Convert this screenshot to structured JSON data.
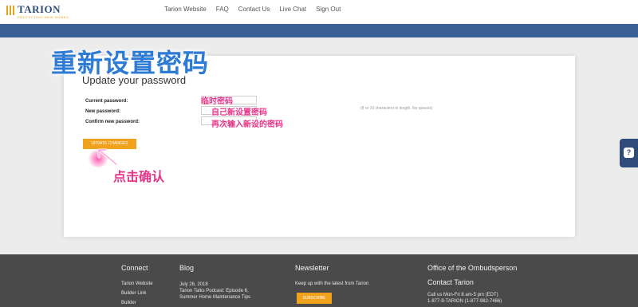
{
  "header": {
    "logo_title": "TARION",
    "logo_subtitle": "PROTECTING NEW HOMES",
    "nav": [
      "Tarion Website",
      "FAQ",
      "Contact Us",
      "Live Chat",
      "Sign Out"
    ]
  },
  "overlay_title": "重新设置密码",
  "form": {
    "title": "Update your password",
    "current_label": "Current password:",
    "new_label": "New password:",
    "confirm_label": "Confirm new password:",
    "hint": "(8 or 10 characters in length, No spaces)",
    "button_label": "UPDATE CHANGES"
  },
  "annotations": {
    "temp_password": "临时密码",
    "set_own_password": "自己新设置密码",
    "reenter_password": "再次输入新设的密码",
    "click_confirm": "点击确认"
  },
  "help": {
    "icon": "?"
  },
  "footer": {
    "connect_title": "Connect",
    "connect_links": [
      "Tarion Website",
      "Builder Link",
      "Builder"
    ],
    "blog_title": "Blog",
    "blog_date": "July 26, 2018",
    "blog_post_1": "Tarion Talks Podcast: Episode 6,",
    "blog_post_2": "Summer Home Maintenance Tips",
    "newsletter_title": "Newsletter",
    "newsletter_text": "Keep up with the latest from Tarion",
    "subscribe_label": "SUBSCRIBE",
    "ombudsperson_title": "Office of the Ombudsperson",
    "contact_title": "Contact Tarion",
    "contact_hours": "Call us Mon-Fri 8 am-5 pm (EDT)",
    "contact_phone": "1-877-9-TARION (1-877-982-7466)"
  },
  "colors": {
    "brand_blue": "#3a5f94",
    "accent_orange": "#f0a21d",
    "annotation_pink": "#e8358a",
    "overlay_blue": "#2e7bd6"
  }
}
